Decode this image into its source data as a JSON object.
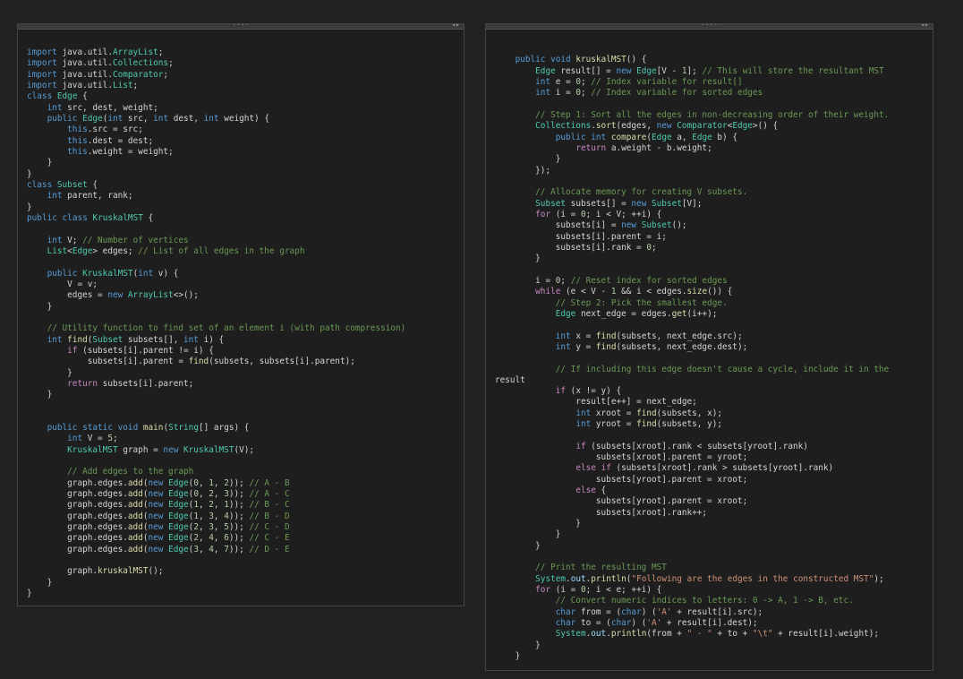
{
  "editor": {
    "left_pane": {
      "grip": "····",
      "controls": "◂▸",
      "lines": [
        "",
        "import java.util.ArrayList;",
        "import java.util.Collections;",
        "import java.util.Comparator;",
        "import java.util.List;",
        "class Edge {",
        "    int src, dest, weight;",
        "    public Edge(int src, int dest, int weight) {",
        "        this.src = src;",
        "        this.dest = dest;",
        "        this.weight = weight;",
        "    }",
        "}",
        "class Subset {",
        "    int parent, rank;",
        "}",
        "public class KruskalMST {",
        "",
        "    int V; // Number of vertices",
        "    List<Edge> edges; // List of all edges in the graph",
        "",
        "    public KruskalMST(int v) {",
        "        V = v;",
        "        edges = new ArrayList<>();",
        "    }",
        "",
        "    // Utility function to find set of an element i (with path compression)",
        "    int find(Subset subsets[], int i) {",
        "        if (subsets[i].parent != i) {",
        "            subsets[i].parent = find(subsets, subsets[i].parent);",
        "        }",
        "        return subsets[i].parent;",
        "    }",
        "",
        "",
        "    public static void main(String[] args) {",
        "        int V = 5;",
        "        KruskalMST graph = new KruskalMST(V);",
        "",
        "        // Add edges to the graph",
        "        graph.edges.add(new Edge(0, 1, 2)); // A - B",
        "        graph.edges.add(new Edge(0, 2, 3)); // A - C",
        "        graph.edges.add(new Edge(1, 2, 1)); // B - C",
        "        graph.edges.add(new Edge(1, 3, 4)); // B - D",
        "        graph.edges.add(new Edge(2, 3, 5)); // C - D",
        "        graph.edges.add(new Edge(2, 4, 6)); // C - E",
        "        graph.edges.add(new Edge(3, 4, 7)); // D - E",
        "",
        "        graph.kruskalMST();",
        "    }",
        "}"
      ]
    },
    "right_pane": {
      "grip": "····",
      "controls": "◂▸",
      "lines": [
        "",
        "",
        "    public void kruskalMST() {",
        "        Edge result[] = new Edge[V - 1]; // This will store the resultant MST",
        "        int e = 0; // Index variable for result[]",
        "        int i = 0; // Index variable for sorted edges",
        "",
        "        // Step 1: Sort all the edges in non-decreasing order of their weight.",
        "        Collections.sort(edges, new Comparator<Edge>() {",
        "            public int compare(Edge a, Edge b) {",
        "                return a.weight - b.weight;",
        "            }",
        "        });",
        "",
        "        // Allocate memory for creating V subsets.",
        "        Subset subsets[] = new Subset[V];",
        "        for (i = 0; i < V; ++i) {",
        "            subsets[i] = new Subset();",
        "            subsets[i].parent = i;",
        "            subsets[i].rank = 0;",
        "        }",
        "",
        "        i = 0; // Reset index for sorted edges",
        "        while (e < V - 1 && i < edges.size()) {",
        "            // Step 2: Pick the smallest edge.",
        "            Edge next_edge = edges.get(i++);",
        "",
        "            int x = find(subsets, next_edge.src);",
        "            int y = find(subsets, next_edge.dest);",
        "",
        "            // If including this edge doesn't cause a cycle, include it in the",
        "result",
        "            if (x != y) {",
        "                result[e++] = next_edge;",
        "                int xroot = find(subsets, x);",
        "                int yroot = find(subsets, y);",
        "",
        "                if (subsets[xroot].rank < subsets[yroot].rank)",
        "                    subsets[xroot].parent = yroot;",
        "                else if (subsets[xroot].rank > subsets[yroot].rank)",
        "                    subsets[yroot].parent = xroot;",
        "                else {",
        "                    subsets[yroot].parent = xroot;",
        "                    subsets[xroot].rank++;",
        "                }",
        "            }",
        "        }",
        "",
        "        // Print the resulting MST",
        "        System.out.println(\"Following are the edges in the constructed MST\");",
        "        for (i = 0; i < e; ++i) {",
        "            // Convert numeric indices to letters: 0 -> A, 1 -> B, etc.",
        "            char from = (char) ('A' + result[i].src);",
        "            char to = (char) ('A' + result[i].dest);",
        "            System.out.println(from + \" - \" + to + \"\\t\" + result[i].weight);",
        "        }",
        "    }"
      ]
    },
    "colors": {
      "background": "#1e1e1e",
      "keyword": "#569cd6",
      "control": "#c586c0",
      "type": "#4ec9b0",
      "function": "#dcdcaa",
      "comment": "#6a9955",
      "string": "#ce9178",
      "number": "#b5cea8"
    }
  }
}
